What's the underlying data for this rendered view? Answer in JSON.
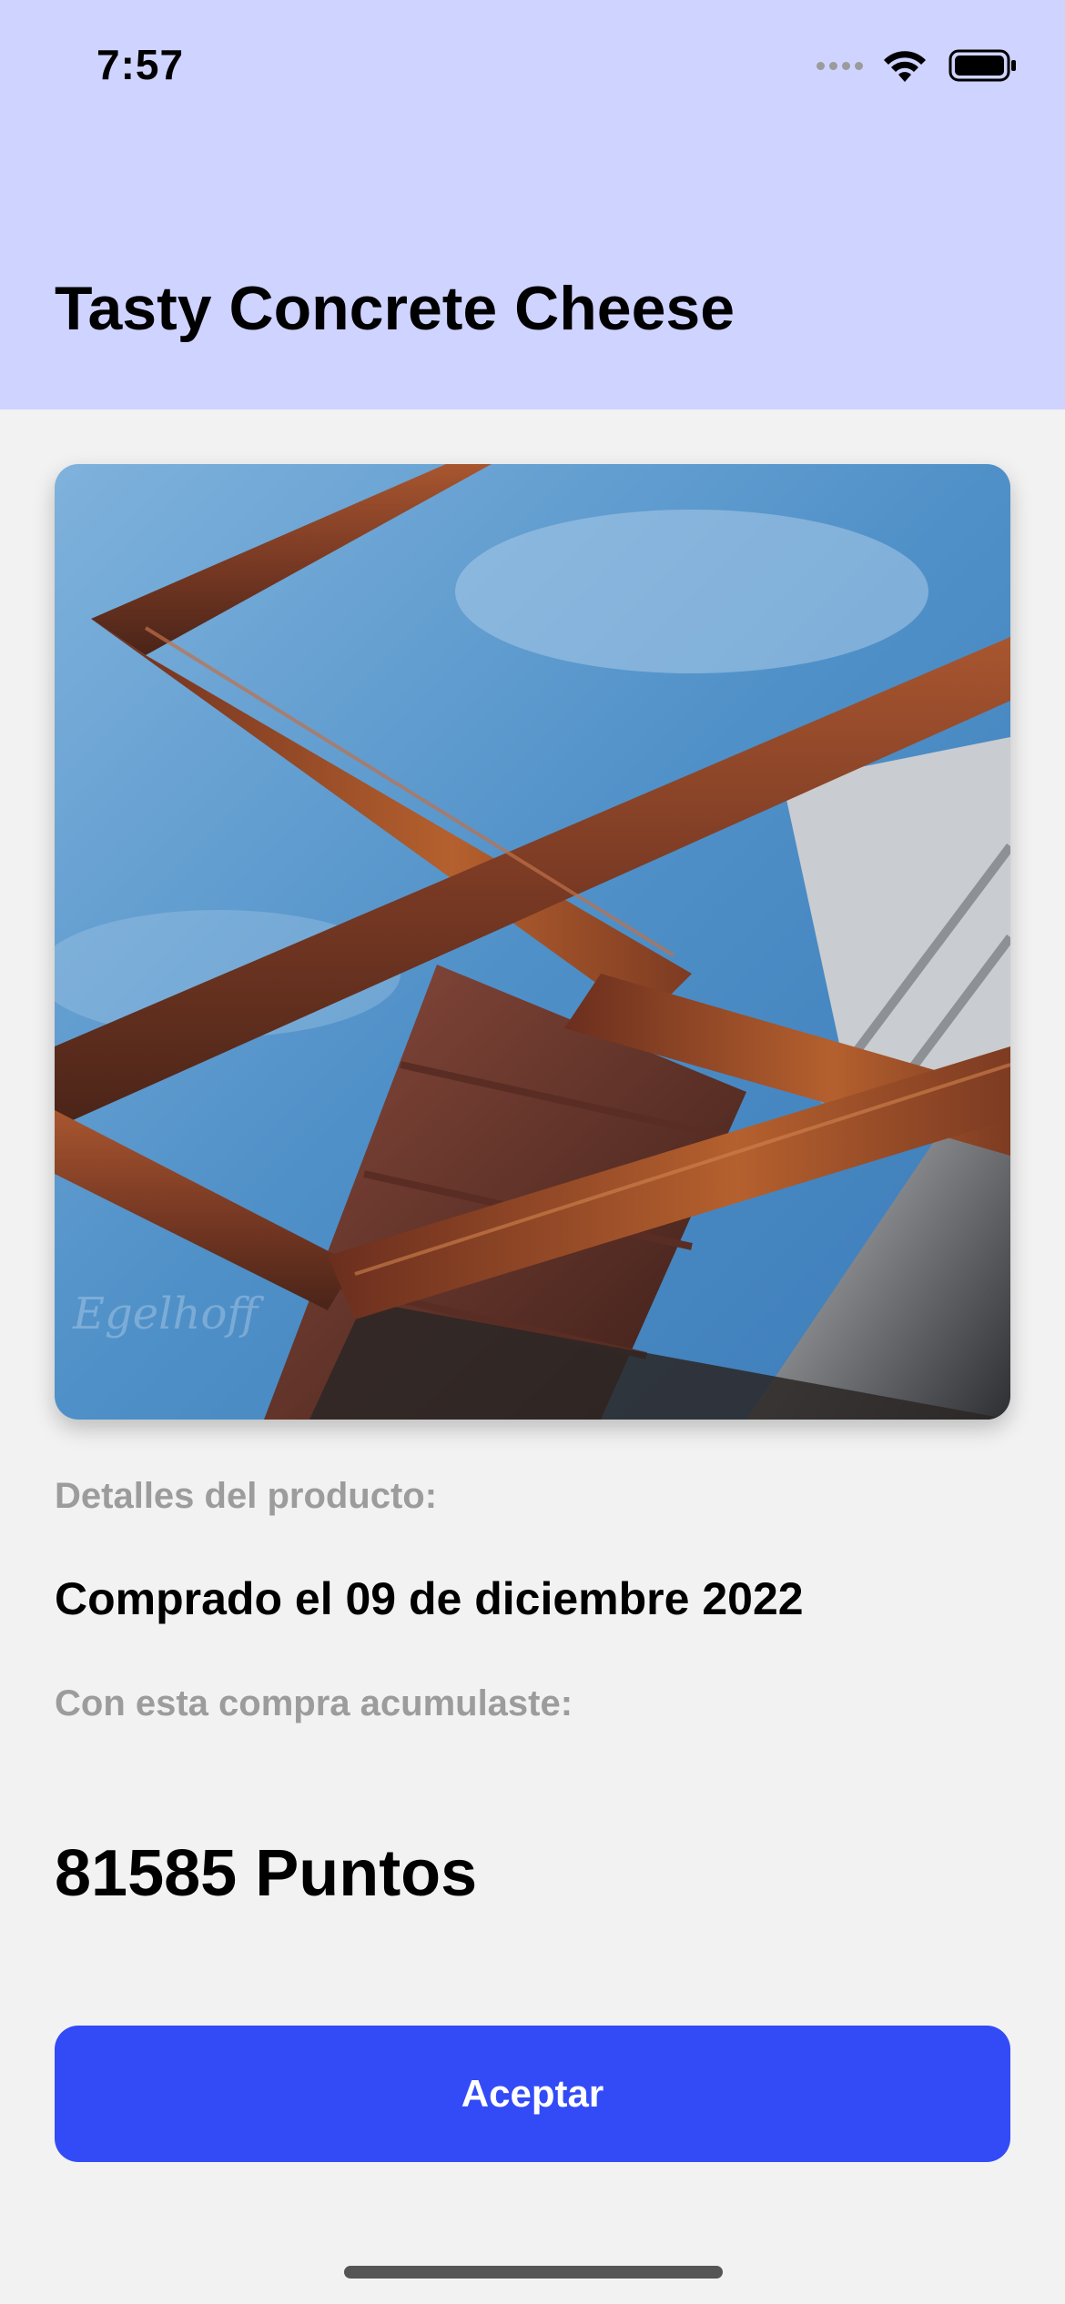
{
  "status_bar": {
    "time": "7:57",
    "icons": [
      "signal-icon",
      "wifi-icon",
      "battery-icon"
    ]
  },
  "header": {
    "title": "Tasty Concrete Cheese",
    "background_color": "#cfd3ff"
  },
  "product": {
    "image_description_icon": "photo-rusty-steel-beams-sky",
    "details_label": "Detalles del producto:",
    "purchase_date": "Comprado el 09 de diciembre 2022",
    "earned_label": "Con esta compra acumulaste:",
    "points": "81585 Puntos"
  },
  "actions": {
    "accept_label": "Aceptar",
    "accept_color": "#334bf7"
  }
}
